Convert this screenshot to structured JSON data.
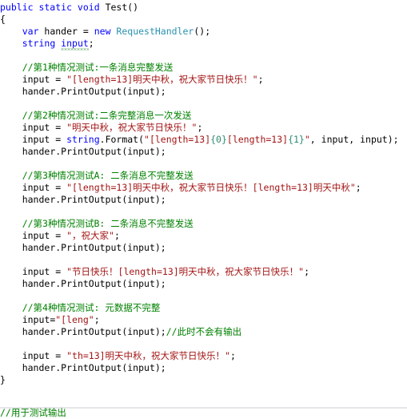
{
  "editor": {
    "language": "C#",
    "background_color": "#FFFFFF",
    "colors": {
      "keyword": "#0000FF",
      "type": "#2B91AF",
      "string": "#A31515",
      "comment": "#008000",
      "format_placeholder": "#2E8B74",
      "plain": "#000000",
      "warning_squiggle": "#2E8B2E",
      "separator": "#E6E6EB"
    }
  },
  "code": {
    "lines": [
      {
        "indent": 0,
        "tokens": [
          {
            "t": "kw",
            "s": "public static void "
          },
          {
            "t": "plain",
            "s": "Test()"
          }
        ]
      },
      {
        "indent": 0,
        "tokens": [
          {
            "t": "plain",
            "s": "{"
          }
        ]
      },
      {
        "indent": 1,
        "tokens": [
          {
            "t": "kw",
            "s": "var "
          },
          {
            "t": "plain",
            "s": "hander = "
          },
          {
            "t": "kw",
            "s": "new "
          },
          {
            "t": "type",
            "s": "RequestHandler"
          },
          {
            "t": "plain",
            "s": "();"
          }
        ]
      },
      {
        "indent": 1,
        "tokens": [
          {
            "t": "kw",
            "s": "string "
          },
          {
            "t": "squiggle",
            "s": "input"
          },
          {
            "t": "plain",
            "s": ";"
          }
        ]
      },
      {
        "indent": 0,
        "tokens": []
      },
      {
        "indent": 1,
        "tokens": [
          {
            "t": "cmt",
            "s": "//第1种情况测试:一条消息完整发送"
          }
        ]
      },
      {
        "indent": 1,
        "tokens": [
          {
            "t": "plain",
            "s": "input = "
          },
          {
            "t": "str",
            "s": "\"[length=13]明天中秋，祝大家节日快乐！\""
          },
          {
            "t": "plain",
            "s": ";"
          }
        ]
      },
      {
        "indent": 1,
        "tokens": [
          {
            "t": "plain",
            "s": "hander.PrintOutput(input);"
          }
        ]
      },
      {
        "indent": 0,
        "tokens": []
      },
      {
        "indent": 1,
        "tokens": [
          {
            "t": "cmt",
            "s": "//第2种情况测试:二条完整消息一次发送"
          }
        ]
      },
      {
        "indent": 1,
        "tokens": [
          {
            "t": "plain",
            "s": "input = "
          },
          {
            "t": "str",
            "s": "\"明天中秋，祝大家节日快乐！\""
          },
          {
            "t": "plain",
            "s": ";"
          }
        ]
      },
      {
        "indent": 1,
        "tokens": [
          {
            "t": "plain",
            "s": "input = "
          },
          {
            "t": "kw",
            "s": "string"
          },
          {
            "t": "plain",
            "s": ".Format("
          },
          {
            "t": "str",
            "s": "\"[length=13]"
          },
          {
            "t": "fmt",
            "s": "{0}"
          },
          {
            "t": "str",
            "s": "[length=13]"
          },
          {
            "t": "fmt",
            "s": "{1}"
          },
          {
            "t": "str",
            "s": "\""
          },
          {
            "t": "plain",
            "s": ", input, input);"
          }
        ]
      },
      {
        "indent": 1,
        "tokens": [
          {
            "t": "plain",
            "s": "hander.PrintOutput(input);"
          }
        ]
      },
      {
        "indent": 0,
        "tokens": []
      },
      {
        "indent": 1,
        "tokens": [
          {
            "t": "cmt",
            "s": "//第3种情况测试A: 二条消息不完整发送"
          }
        ]
      },
      {
        "indent": 1,
        "tokens": [
          {
            "t": "plain",
            "s": "input = "
          },
          {
            "t": "str",
            "s": "\"[length=13]明天中秋，祝大家节日快乐！[length=13]明天中秋\""
          },
          {
            "t": "plain",
            "s": ";"
          }
        ]
      },
      {
        "indent": 1,
        "tokens": [
          {
            "t": "plain",
            "s": "hander.PrintOutput(input);"
          }
        ]
      },
      {
        "indent": 0,
        "tokens": []
      },
      {
        "indent": 1,
        "tokens": [
          {
            "t": "cmt",
            "s": "//第3种情况测试B: 二条消息不完整发送"
          }
        ]
      },
      {
        "indent": 1,
        "tokens": [
          {
            "t": "plain",
            "s": "input = "
          },
          {
            "t": "str",
            "s": "\"，祝大家\""
          },
          {
            "t": "plain",
            "s": ";"
          }
        ]
      },
      {
        "indent": 1,
        "tokens": [
          {
            "t": "plain",
            "s": "hander.PrintOutput(input);"
          }
        ]
      },
      {
        "indent": 0,
        "tokens": []
      },
      {
        "indent": 1,
        "tokens": [
          {
            "t": "plain",
            "s": "input = "
          },
          {
            "t": "str",
            "s": "\"节日快乐！[length=13]明天中秋，祝大家节日快乐！\""
          },
          {
            "t": "plain",
            "s": ";"
          }
        ]
      },
      {
        "indent": 1,
        "tokens": [
          {
            "t": "plain",
            "s": "hander.PrintOutput(input);"
          }
        ]
      },
      {
        "indent": 0,
        "tokens": []
      },
      {
        "indent": 1,
        "tokens": [
          {
            "t": "cmt",
            "s": "//第4种情况测试: 元数据不完整"
          }
        ]
      },
      {
        "indent": 1,
        "tokens": [
          {
            "t": "plain",
            "s": "input="
          },
          {
            "t": "str",
            "s": "\"[leng\""
          },
          {
            "t": "plain",
            "s": ";"
          }
        ]
      },
      {
        "indent": 1,
        "tokens": [
          {
            "t": "plain",
            "s": "hander.PrintOutput(input);"
          },
          {
            "t": "cmt",
            "s": "//此时不会有输出"
          }
        ]
      },
      {
        "indent": 0,
        "tokens": []
      },
      {
        "indent": 1,
        "tokens": [
          {
            "t": "plain",
            "s": "input = "
          },
          {
            "t": "str",
            "s": "\"th=13]明天中秋，祝大家节日快乐！\""
          },
          {
            "t": "plain",
            "s": ";"
          }
        ]
      },
      {
        "indent": 1,
        "tokens": [
          {
            "t": "plain",
            "s": "hander.PrintOutput(input);"
          }
        ]
      },
      {
        "indent": 0,
        "tokens": [
          {
            "t": "plain",
            "s": "}"
          }
        ]
      }
    ],
    "clipped_bottom_line": "//用于测试输出"
  }
}
